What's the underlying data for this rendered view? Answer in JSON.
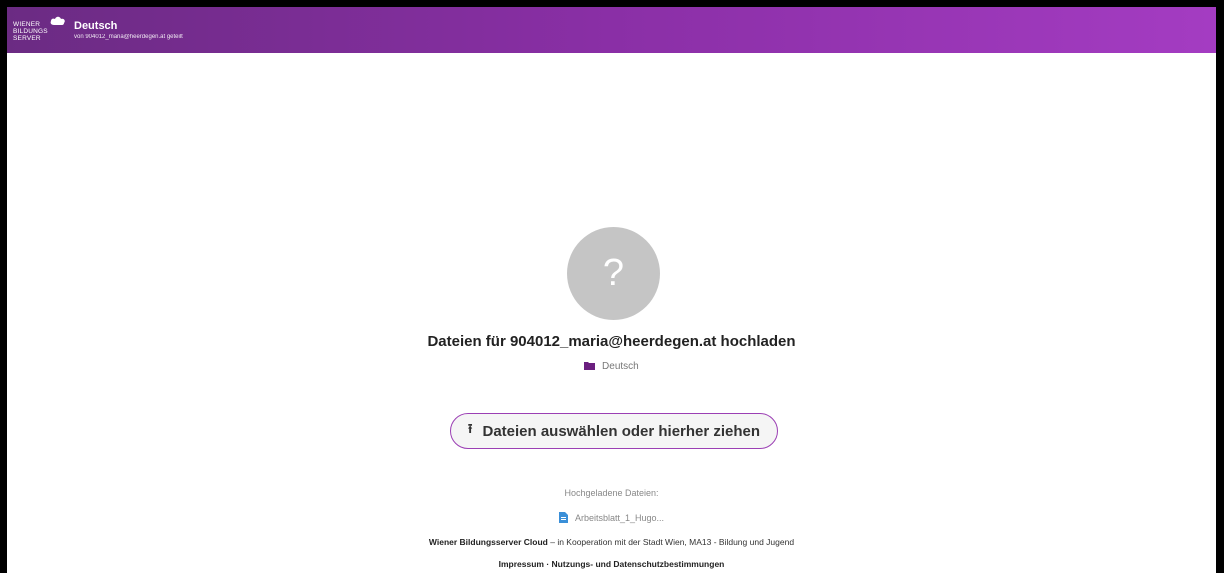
{
  "header": {
    "logo_lines": [
      "WIENER",
      "BILDUNGS",
      "SERVER"
    ],
    "share_title": "Deutsch",
    "share_subtitle": "von 904012_maria@heerdegen.at geteilt",
    "background_color": "#8a2fa6"
  },
  "main": {
    "avatar_symbol": "?",
    "upload_title": "Dateien für 904012_maria@heerdegen.at hochladen",
    "folder_icon": "folder-icon",
    "folder_name": "Deutsch",
    "upload_button_icon": "upload-icon",
    "upload_button_label": "Dateien auswählen oder hierher ziehen",
    "uploaded_label": "Hochgeladene Dateien:",
    "uploaded_files": [
      {
        "icon": "document-icon",
        "name": "Arbeitsblatt_1_Hugo..."
      }
    ]
  },
  "footer": {
    "org_name": "Wiener Bildungsserver Cloud",
    "org_tagline": " – in Kooperation mit der Stadt Wien, MA13 - Bildung und Jugend",
    "link_impressum": "Impressum",
    "separator": " · ",
    "link_privacy": "Nutzungs- und Datenschutzbestimmungen"
  },
  "colors": {
    "accent": "#9b3fb4",
    "folder": "#6b1f7f",
    "document": "#3a8fd8"
  }
}
